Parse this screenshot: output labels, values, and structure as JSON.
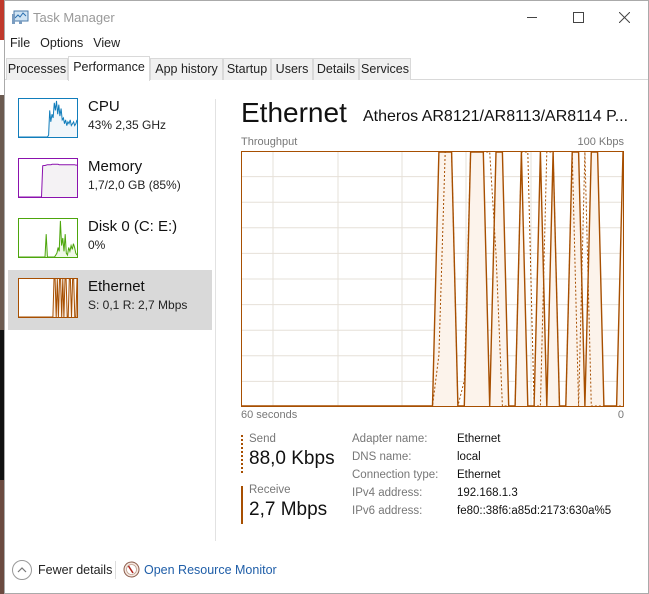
{
  "window": {
    "title": "Task Manager",
    "controls": {
      "minimize": "minimize",
      "maximize": "maximize",
      "close": "close"
    }
  },
  "menu": [
    "File",
    "Options",
    "View"
  ],
  "tabs": [
    {
      "label": "Processes",
      "active": false
    },
    {
      "label": "Performance",
      "active": true
    },
    {
      "label": "App history",
      "active": false
    },
    {
      "label": "Startup",
      "active": false
    },
    {
      "label": "Users",
      "active": false
    },
    {
      "label": "Details",
      "active": false
    },
    {
      "label": "Services",
      "active": false
    }
  ],
  "sidebar": {
    "items": [
      {
        "name": "CPU",
        "sub": "43%  2,35 GHz",
        "color": "#117dbb",
        "fill": "#f1f6fa",
        "selected": false,
        "history": [
          0,
          0,
          0,
          0,
          0,
          0,
          0,
          0,
          0,
          0,
          0,
          0,
          0,
          0,
          0,
          0,
          0,
          0,
          0,
          0,
          0,
          0,
          0,
          0,
          0,
          0,
          0.05,
          0.7,
          0.4,
          0.6,
          0.5,
          0.9,
          0.7,
          0.95,
          0.6,
          0.85,
          0.55,
          0.75,
          0.45,
          0.5,
          0.35,
          0.45,
          0.3,
          0.4,
          0.35,
          0.45,
          0.3,
          0.35,
          0.4,
          0.3,
          0.35,
          0.45
        ]
      },
      {
        "name": "Memory",
        "sub": "1,7/2,0 GB (85%)",
        "color": "#8b12ae",
        "fill": "#f4f2f4",
        "selected": false,
        "history": [
          0,
          0,
          0,
          0,
          0,
          0,
          0,
          0,
          0,
          0,
          0,
          0,
          0,
          0,
          0,
          0,
          0,
          0,
          0,
          0,
          0.82,
          0.83,
          0.83,
          0.84,
          0.85,
          0.85,
          0.85,
          0.85,
          0.86,
          0.86,
          0.86,
          0.86,
          0.86,
          0.86,
          0.85,
          0.85,
          0.85,
          0.85,
          0.85,
          0.85,
          0.85,
          0.85,
          0.85,
          0.85,
          0.85,
          0.85,
          0.85,
          0.85,
          0.84,
          0.84
        ]
      },
      {
        "name": "Disk 0 (C: E:)",
        "sub": "0%",
        "color": "#4da60c",
        "fill": "#eff7e7",
        "selected": false,
        "history": [
          0,
          0,
          0,
          0,
          0,
          0,
          0,
          0,
          0,
          0,
          0,
          0,
          0,
          0,
          0,
          0,
          0,
          0,
          0,
          0,
          0,
          0,
          0,
          0.6,
          0,
          0,
          0,
          0,
          0,
          0,
          0,
          0.05,
          0.1,
          0.25,
          0.15,
          0.95,
          0.3,
          0.5,
          0.15,
          0.6,
          0.1,
          0.05,
          0.25,
          0.15,
          0.3,
          0.2,
          0.35,
          0.25,
          0.1,
          0.05
        ]
      },
      {
        "name": "Ethernet",
        "sub": "S: 0,1  R: 2,7 Mbps",
        "color": "#a74f01",
        "fill": "#fcf3eb",
        "selected": true,
        "history": [
          0,
          0,
          0,
          0,
          0,
          0,
          0,
          0,
          0,
          0,
          0,
          0,
          0,
          0,
          0,
          0,
          0,
          0,
          0,
          0,
          0,
          0,
          0,
          0,
          0,
          0,
          0,
          0,
          0,
          0,
          0,
          0,
          1,
          1,
          0,
          1,
          0,
          1,
          1,
          0,
          1,
          0,
          1,
          1,
          0,
          0,
          1,
          1,
          0,
          1,
          1,
          0,
          0,
          1
        ]
      }
    ]
  },
  "main": {
    "title": "Ethernet",
    "adapter": "Atheros AR8121/AR8113/AR8114 P...",
    "chart_label": "Throughput",
    "chart_max_label": "100 Kbps",
    "x_left_label": "60 seconds",
    "x_right_label": "0",
    "send": {
      "label": "Send",
      "value": "88,0 Kbps"
    },
    "receive": {
      "label": "Receive",
      "value": "2,7 Mbps"
    },
    "properties": [
      {
        "key": "Adapter name:",
        "value": "Ethernet"
      },
      {
        "key": "DNS name:",
        "value": "local"
      },
      {
        "key": "Connection type:",
        "value": "Ethernet"
      },
      {
        "key": "IPv4 address:",
        "value": "192.168.1.3"
      },
      {
        "key": "IPv6 address:",
        "value": "fe80::38f6:a85d:2173:630a%5"
      }
    ]
  },
  "footer": {
    "fewer_details": "Fewer details",
    "open_resource_monitor": "Open Resource Monitor"
  },
  "colors": {
    "ethernet_line": "#a74f01",
    "ethernet_fill": "#fcf3eb",
    "grid": "#e6e0d8",
    "link": "#1f5ea8"
  },
  "chart_data": {
    "type": "area",
    "title": "Throughput",
    "ylabel": "Kbps",
    "ylim": [
      0,
      100
    ],
    "xlim": [
      60,
      0
    ],
    "xlabel_left": "60 seconds",
    "xlabel_right": "0",
    "x": [
      60,
      59,
      58,
      57,
      56,
      55,
      54,
      53,
      52,
      51,
      50,
      49,
      48,
      47,
      46,
      45,
      44,
      43,
      42,
      41,
      40,
      39,
      38,
      37,
      36,
      35,
      34,
      33,
      32,
      31,
      30,
      29,
      28,
      27,
      26,
      25,
      24,
      23,
      22,
      21,
      20,
      19,
      18,
      17,
      16,
      15,
      14,
      13,
      12,
      11,
      10,
      9,
      8,
      7,
      6,
      5,
      4,
      3,
      2,
      1,
      0
    ],
    "series": [
      {
        "name": "Receive",
        "style": "solid",
        "values": [
          0,
          0,
          0,
          0,
          0,
          0,
          0,
          0,
          0,
          0,
          0,
          0,
          0,
          0,
          0,
          0,
          0,
          0,
          0,
          0,
          0,
          0,
          0,
          0,
          0,
          0,
          0,
          0,
          0,
          0,
          0,
          100,
          100,
          100,
          0,
          0,
          100,
          100,
          100,
          0,
          100,
          100,
          0,
          0,
          100,
          0,
          0,
          100,
          0,
          100,
          0,
          0,
          100,
          100,
          0,
          100,
          100,
          0,
          0,
          0,
          100
        ]
      },
      {
        "name": "Send",
        "style": "dashed",
        "values": [
          0,
          0,
          0,
          0,
          0,
          0,
          0,
          0,
          0,
          0,
          0,
          0,
          0,
          0,
          0,
          0,
          0,
          0,
          0,
          0,
          0,
          0,
          0,
          0,
          0,
          0,
          0,
          0,
          0,
          0,
          0,
          20,
          100,
          100,
          0,
          10,
          100,
          100,
          100,
          100,
          60,
          0,
          0,
          0,
          100,
          100,
          0,
          0,
          100,
          100,
          0,
          0,
          100,
          0,
          100,
          0,
          0,
          0,
          0,
          0,
          0
        ]
      }
    ],
    "grid": true
  }
}
